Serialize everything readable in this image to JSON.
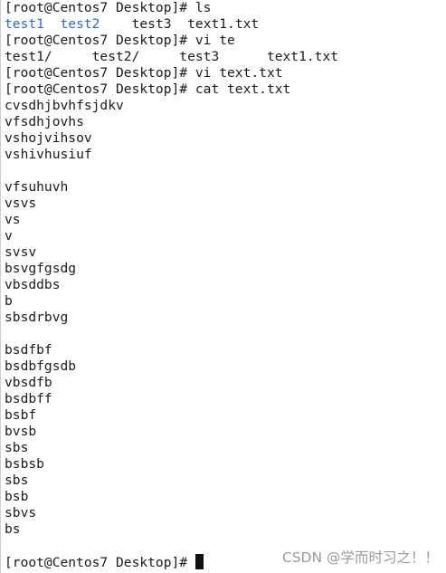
{
  "prompt": "[root@Centos7 Desktop]# ",
  "lines": [
    {
      "type": "cmd",
      "text": "ls"
    },
    {
      "type": "ls-out",
      "dirs": [
        "test1",
        "test2"
      ],
      "files": [
        "test3",
        "text1.txt"
      ]
    },
    {
      "type": "cmd",
      "text": "vi te"
    },
    {
      "type": "raw",
      "text": "test1/     test2/     test3      text1.txt"
    },
    {
      "type": "cmd",
      "text": "vi text.txt"
    },
    {
      "type": "cmd",
      "text": "cat text.txt"
    },
    {
      "type": "raw",
      "text": "cvsdhjbvhfsjdkv"
    },
    {
      "type": "raw",
      "text": "vfsdhjovhs"
    },
    {
      "type": "raw",
      "text": "vshojvihsov"
    },
    {
      "type": "raw",
      "text": "vshivhusiuf"
    },
    {
      "type": "raw",
      "text": ""
    },
    {
      "type": "raw",
      "text": "vfsuhuvh"
    },
    {
      "type": "raw",
      "text": "vsvs"
    },
    {
      "type": "raw",
      "text": "vs"
    },
    {
      "type": "raw",
      "text": "v"
    },
    {
      "type": "raw",
      "text": "svsv"
    },
    {
      "type": "raw",
      "text": "bsvgfgsdg"
    },
    {
      "type": "raw",
      "text": "vbsddbs"
    },
    {
      "type": "raw",
      "text": "b"
    },
    {
      "type": "raw",
      "text": "sbsdrbvg"
    },
    {
      "type": "raw",
      "text": ""
    },
    {
      "type": "raw",
      "text": "bsdfbf"
    },
    {
      "type": "raw",
      "text": "bsdbfgsdb"
    },
    {
      "type": "raw",
      "text": "vbsdfb"
    },
    {
      "type": "raw",
      "text": "bsdbff"
    },
    {
      "type": "raw",
      "text": "bsbf"
    },
    {
      "type": "raw",
      "text": "bvsb"
    },
    {
      "type": "raw",
      "text": "sbs"
    },
    {
      "type": "raw",
      "text": "bsbsb"
    },
    {
      "type": "raw",
      "text": "sbs"
    },
    {
      "type": "raw",
      "text": "bsb"
    },
    {
      "type": "raw",
      "text": "sbvs"
    },
    {
      "type": "raw",
      "text": "bs"
    },
    {
      "type": "raw",
      "text": ""
    },
    {
      "type": "input",
      "text": ""
    }
  ],
  "watermark": "CSDN @学而时习之！！",
  "colors": {
    "directory": "#2a6cd8",
    "text": "#1a1a1a",
    "background": "#ffffff"
  }
}
